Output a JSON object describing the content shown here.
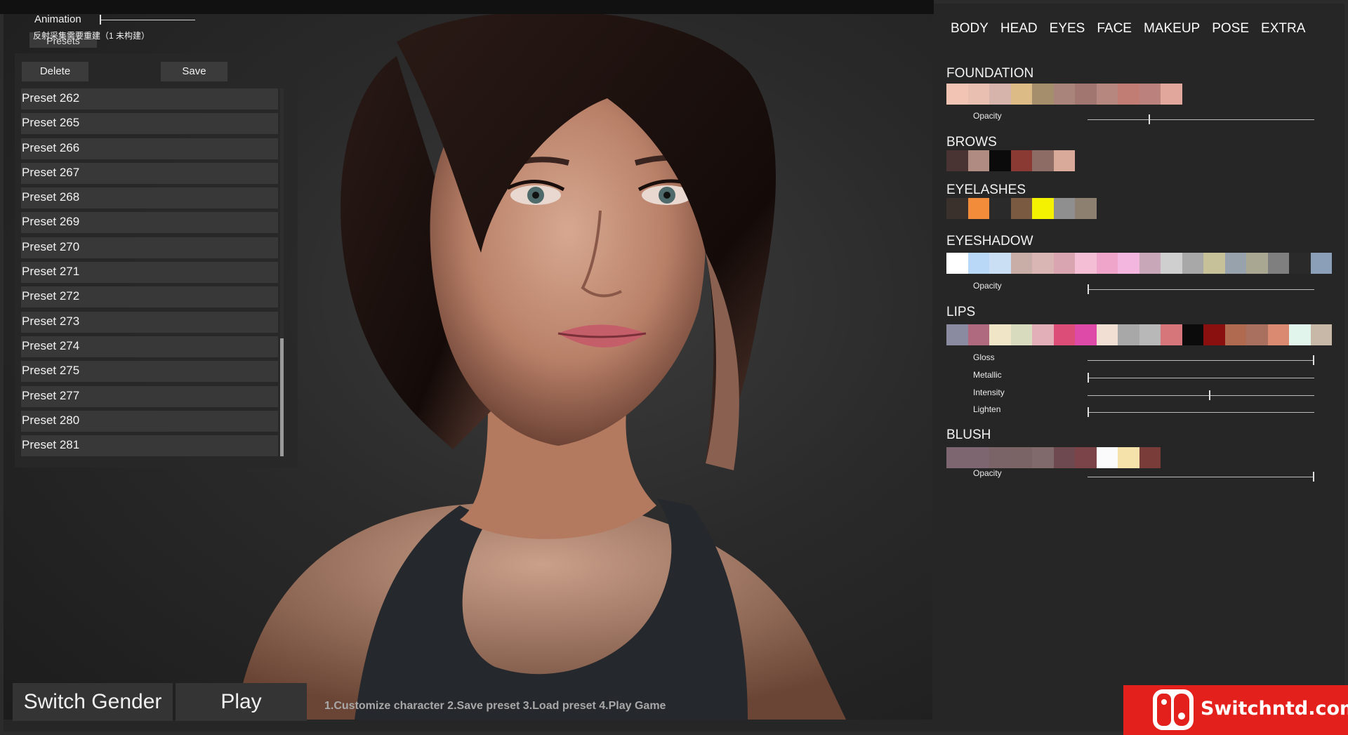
{
  "animation": {
    "label": "Animation",
    "value": 0.0
  },
  "rebuild_note": "反射采集需要重建（1 未构建）",
  "presets_tab": "Presets",
  "buttons": {
    "delete": "Delete",
    "save": "Save",
    "switch_gender": "Switch Gender",
    "play": "Play"
  },
  "presets": [
    "Preset 262",
    "Preset 265",
    "Preset 266",
    "Preset 267",
    "Preset 268",
    "Preset 269",
    "Preset 270",
    "Preset 271",
    "Preset 272",
    "Preset 273",
    "Preset 274",
    "Preset 275",
    "Preset 277",
    "Preset 280",
    "Preset 281"
  ],
  "instructions": "1.Customize  character  2.Save preset  3.Load preset  4.Play Game",
  "tabs": [
    "BODY",
    "HEAD",
    "EYES",
    "FACE",
    "MAKEUP",
    "POSE",
    "EXTRA"
  ],
  "sections": {
    "foundation": {
      "title": "FOUNDATION",
      "colors": [
        "#f2c4b4",
        "#e9bfb2",
        "#d6b3ab",
        "#dcbb86",
        "#a48e6c",
        "#a9847a",
        "#a17570",
        "#b5877f",
        "#c17d73",
        "#bb817c",
        "#e2a79c"
      ],
      "opacity_label": "Opacity",
      "opacity": 0.27
    },
    "brows": {
      "title": "BROWS",
      "colors": [
        "#4a3433",
        "#b08b82",
        "#0b0b0b",
        "#8a3a33",
        "#8c6c64",
        "#d9aa9a"
      ]
    },
    "eyelashes": {
      "title": "EYELASHES",
      "colors": [
        "#3a302c",
        "#f28c3a",
        "#2a2a2a",
        "#7a5a40",
        "#f4f200",
        "#8f8f8f",
        "#8e8070"
      ]
    },
    "eyeshadow": {
      "title": "EYESHADOW",
      "colors": [
        "#ffffff",
        "#b9d7f6",
        "#cadff4",
        "#c8aea6",
        "#d9b6b3",
        "#d8a5b1",
        "#f4bfd5",
        "#efa5c9",
        "#f2b6df",
        "#c8a7b8",
        "#cfcfcf",
        "#a8a8a8",
        "#c7c19a",
        "#98a2ac",
        "#a9a691",
        "#7f7f7f",
        "#2a2a2a",
        "#8b9fb8"
      ],
      "opacity_label": "Opacity",
      "opacity": 0.0
    },
    "lips": {
      "title": "LIPS",
      "colors": [
        "#8a8aa0",
        "#b06a80",
        "#f1e5c8",
        "#d9dbbf",
        "#e2aeb8",
        "#dc4e78",
        "#dd4aa8",
        "#f1dfd4",
        "#a8a8a8",
        "#b8b8b8",
        "#d7767a",
        "#0b0b0b",
        "#8a0f0f",
        "#b06a50",
        "#a97060",
        "#d98a70",
        "#e2f5ec",
        "#c8b8a8"
      ],
      "sliders": [
        {
          "label": "Gloss",
          "value": 1.0
        },
        {
          "label": "Metallic",
          "value": 0.0
        },
        {
          "label": "Intensity",
          "value": 0.54
        },
        {
          "label": "Lighten",
          "value": 0.0
        }
      ]
    },
    "blush": {
      "title": "BLUSH",
      "colors": [
        "#7e6670",
        "#7e6670",
        "#7b6468",
        "#7a6466",
        "#806a6c",
        "#6e4a50",
        "#7a4448",
        "#fbfbfb",
        "#f4e2aa",
        "#7a3c38"
      ],
      "opacity_label": "Opacity",
      "opacity": 1.0
    }
  },
  "watermark": "Switchntd.com"
}
